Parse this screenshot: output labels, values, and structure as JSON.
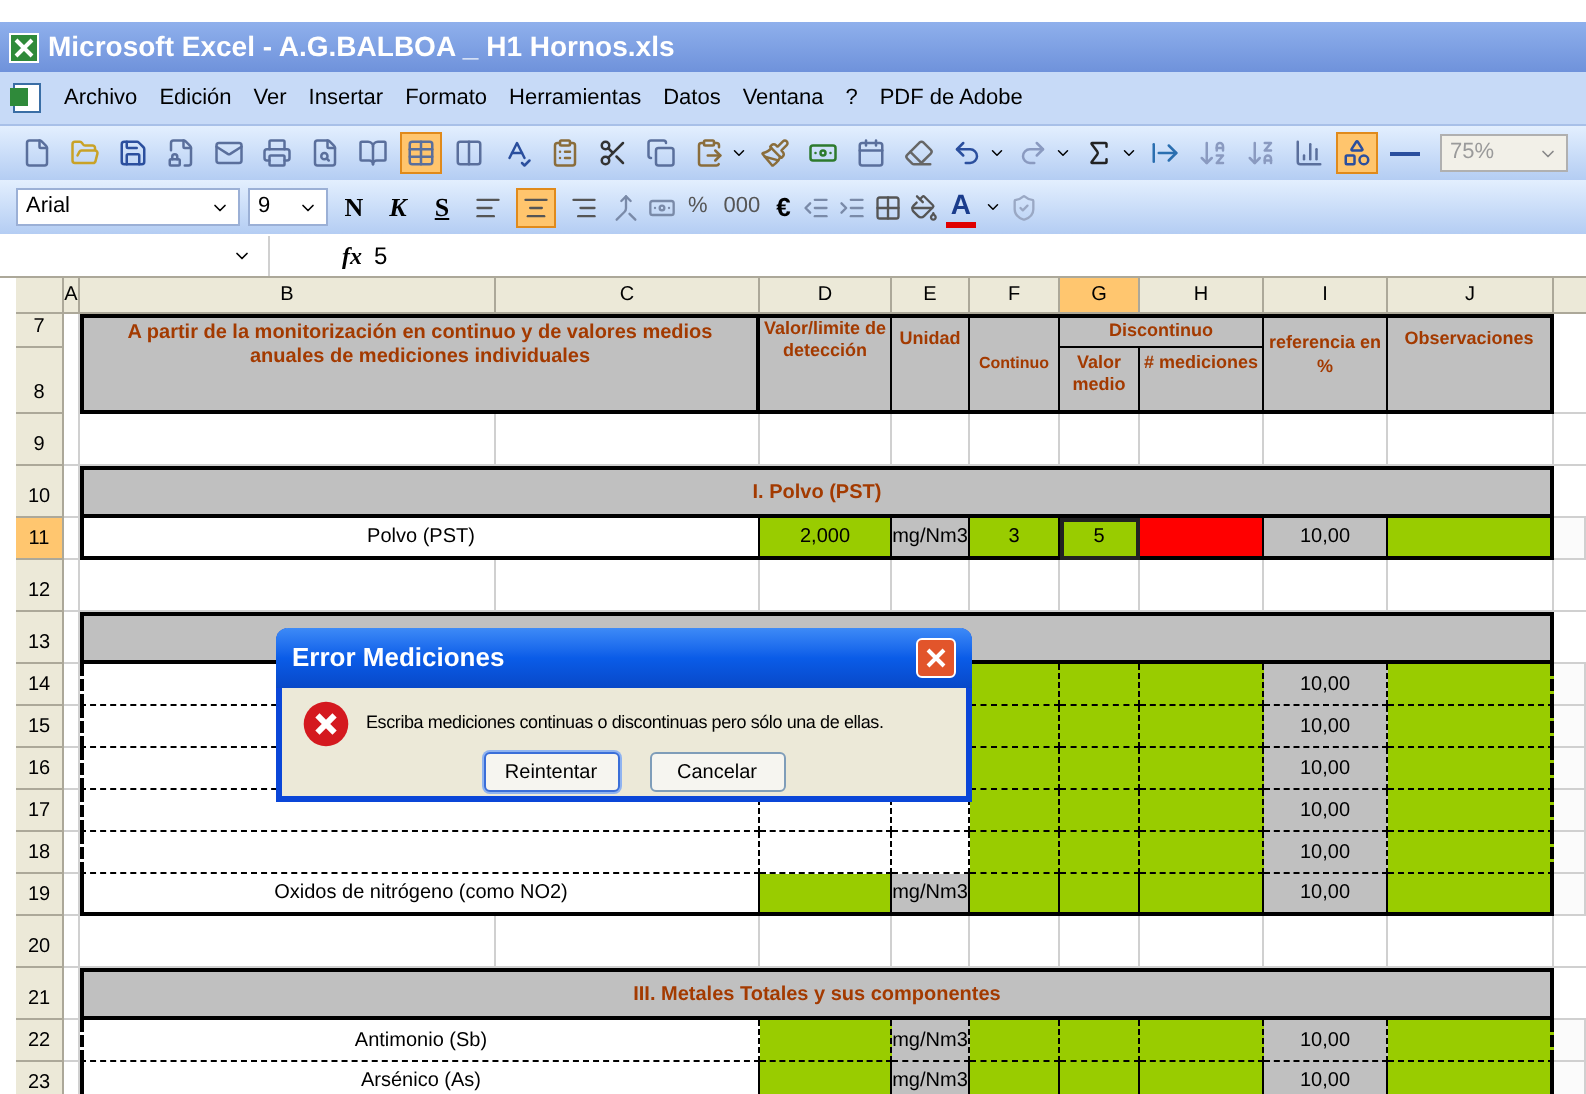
{
  "window": {
    "title": "Microsoft Excel - A.G.BALBOA _ H1 Hornos.xls"
  },
  "menu": [
    "Archivo",
    "Edición",
    "Ver",
    "Insertar",
    "Formato",
    "Herramientas",
    "Datos",
    "Ventana",
    "?",
    "PDF de Adobe"
  ],
  "standard_toolbar": {
    "buttons": [
      {
        "kind": "new",
        "selected": false
      },
      {
        "kind": "open",
        "selected": false
      },
      {
        "kind": "save",
        "selected": false
      },
      {
        "kind": "permission",
        "selected": false
      },
      {
        "kind": "mail",
        "selected": false
      },
      {
        "kind": "print",
        "selected": false
      },
      {
        "kind": "preview",
        "selected": false
      },
      {
        "kind": "research",
        "selected": false
      },
      {
        "kind": "grid",
        "selected": true
      },
      {
        "kind": "columns",
        "selected": false
      },
      {
        "kind": "spell",
        "selected": false
      },
      {
        "kind": "clipboard",
        "selected": false
      },
      {
        "kind": "cut",
        "selected": false
      },
      {
        "kind": "copy",
        "selected": false
      },
      {
        "kind": "paste",
        "selected": false
      },
      {
        "kind": "brush",
        "selected": false
      },
      {
        "kind": "money",
        "selected": false
      },
      {
        "kind": "calendar",
        "selected": false
      },
      {
        "kind": "eraser",
        "selected": false
      },
      {
        "kind": "undo",
        "selected": false
      },
      {
        "kind": "redo",
        "selected": false
      },
      {
        "kind": "sum",
        "selected": false
      },
      {
        "kind": "trace",
        "selected": false
      },
      {
        "kind": "sort_asc",
        "selected": false
      },
      {
        "kind": "sort_desc",
        "selected": false
      },
      {
        "kind": "chart",
        "selected": false
      },
      {
        "kind": "drawing",
        "selected": true
      },
      {
        "kind": "line",
        "selected": false
      }
    ],
    "zoom": "75%"
  },
  "format_toolbar": {
    "font": "Arial",
    "size": "9",
    "style_buttons": [
      "N",
      "K",
      "S"
    ],
    "align_buttons": [
      {
        "selected": false
      },
      {
        "selected": true
      },
      {
        "selected": false
      }
    ],
    "number_buttons": [
      "%",
      "000",
      "€"
    ],
    "font_color_letter": "A"
  },
  "formula_bar": {
    "function_label": "fx",
    "value": "5"
  },
  "columns": [
    {
      "label": "A",
      "selected": false
    },
    {
      "label": "B",
      "selected": false
    },
    {
      "label": "C",
      "selected": false
    },
    {
      "label": "D",
      "selected": false
    },
    {
      "label": "E",
      "selected": false
    },
    {
      "label": "F",
      "selected": false
    },
    {
      "label": "G",
      "selected": true
    },
    {
      "label": "H",
      "selected": false
    },
    {
      "label": "I",
      "selected": false
    },
    {
      "label": "J",
      "selected": false
    }
  ],
  "header": {
    "row_numbers": [
      "7",
      "8"
    ],
    "description": "A partir de la monitorización en continuo y de valores medios anuales de mediciones individuales",
    "limit": "Valor/limite de detección",
    "unit": "Unidad",
    "continuous": "Continuo",
    "discontinuous": "Discontinuo",
    "mean": "Valor medio",
    "count": "# mediciones",
    "reference": "referencia en %",
    "notes": "Observaciones"
  },
  "rows": [
    {
      "number": "9",
      "selected": false,
      "kind": "blank"
    },
    {
      "number": "10",
      "selected": false,
      "kind": "section",
      "title": "I. Polvo (PST)"
    },
    {
      "number": "11",
      "selected": true,
      "kind": "data",
      "cells": [
        {
          "text": "Polvo (PST)",
          "color": "#ffffff",
          "selected": false
        },
        {
          "text": "2,000",
          "color": "#99cc00",
          "selected": false
        },
        {
          "text": "mg/Nm3",
          "color": "#c0c0c0",
          "selected": false
        },
        {
          "text": "3",
          "color": "#99cc00",
          "selected": false
        },
        {
          "text": "5",
          "color": "#99cc00",
          "selected": true
        },
        {
          "color": "#ff0000",
          "selected": false
        },
        {
          "text": "10,00",
          "color": "#c0c0c0",
          "selected": false
        },
        {
          "color": "#99cc00",
          "selected": false
        }
      ]
    },
    {
      "number": "12",
      "selected": false,
      "kind": "blank"
    },
    {
      "number": "13",
      "selected": false,
      "kind": "section"
    },
    {
      "number": "14",
      "selected": false,
      "kind": "data",
      "cells": [
        {},
        {},
        {},
        {
          "color": "#99cc00",
          "selected": false
        },
        {
          "color": "#99cc00",
          "selected": false
        },
        {
          "color": "#99cc00",
          "selected": false
        },
        {
          "text": "10,00",
          "color": "#c0c0c0",
          "selected": false
        },
        {
          "color": "#99cc00",
          "selected": false
        }
      ]
    },
    {
      "number": "15",
      "selected": false,
      "kind": "data",
      "cells": [
        {},
        {},
        {},
        {
          "color": "#99cc00",
          "selected": false
        },
        {
          "color": "#99cc00",
          "selected": false
        },
        {
          "color": "#99cc00",
          "selected": false
        },
        {
          "text": "10,00",
          "color": "#c0c0c0",
          "selected": false
        },
        {
          "color": "#99cc00",
          "selected": false
        }
      ]
    },
    {
      "number": "16",
      "selected": false,
      "kind": "data",
      "cells": [
        {},
        {},
        {},
        {
          "color": "#99cc00",
          "selected": false
        },
        {
          "color": "#99cc00",
          "selected": false
        },
        {
          "color": "#99cc00",
          "selected": false
        },
        {
          "text": "10,00",
          "color": "#c0c0c0",
          "selected": false
        },
        {
          "color": "#99cc00",
          "selected": false
        }
      ]
    },
    {
      "number": "17",
      "selected": false,
      "kind": "data",
      "cells": [
        {},
        {},
        {},
        {
          "color": "#99cc00",
          "selected": false
        },
        {
          "color": "#99cc00",
          "selected": false
        },
        {
          "color": "#99cc00",
          "selected": false
        },
        {
          "text": "10,00",
          "color": "#c0c0c0",
          "selected": false
        },
        {
          "color": "#99cc00",
          "selected": false
        }
      ]
    },
    {
      "number": "18",
      "selected": false,
      "kind": "data",
      "cells": [
        {},
        {},
        {},
        {
          "color": "#99cc00",
          "selected": false
        },
        {
          "color": "#99cc00",
          "selected": false
        },
        {
          "color": "#99cc00",
          "selected": false
        },
        {
          "text": "10,00",
          "color": "#c0c0c0",
          "selected": false
        },
        {
          "color": "#99cc00",
          "selected": false
        }
      ]
    },
    {
      "number": "19",
      "selected": false,
      "kind": "data",
      "cells": [
        {
          "text": "Oxidos de nitrógeno  (como NO2)",
          "color": "#ffffff",
          "selected": false
        },
        {
          "color": "#99cc00",
          "selected": false
        },
        {
          "text": "mg/Nm3",
          "color": "#c0c0c0",
          "selected": false
        },
        {
          "color": "#99cc00",
          "selected": false
        },
        {
          "color": "#99cc00",
          "selected": false
        },
        {
          "color": "#99cc00",
          "selected": false
        },
        {
          "text": "10,00",
          "color": "#c0c0c0",
          "selected": false
        },
        {
          "color": "#99cc00",
          "selected": false
        }
      ]
    },
    {
      "number": "20",
      "selected": false,
      "kind": "blank"
    },
    {
      "number": "21",
      "selected": false,
      "kind": "section",
      "title": "III. Metales Totales y sus componentes"
    },
    {
      "number": "22",
      "selected": false,
      "kind": "data",
      "cells": [
        {
          "text": "Antimonio (Sb)",
          "color": "#ffffff",
          "selected": false
        },
        {
          "color": "#99cc00",
          "selected": false
        },
        {
          "text": "mg/Nm3",
          "color": "#c0c0c0",
          "selected": false
        },
        {
          "color": "#99cc00",
          "selected": false
        },
        {
          "color": "#99cc00",
          "selected": false
        },
        {
          "color": "#99cc00",
          "selected": false
        },
        {
          "text": "10,00",
          "color": "#c0c0c0",
          "selected": false
        },
        {
          "color": "#99cc00",
          "selected": false
        }
      ]
    },
    {
      "number": "23",
      "selected": false,
      "kind": "data",
      "cells": [
        {
          "text": "Arsénico (As)",
          "color": "#ffffff",
          "selected": false
        },
        {
          "color": "#99cc00",
          "selected": false
        },
        {
          "text": "mg/Nm3",
          "color": "#c0c0c0",
          "selected": false
        },
        {
          "color": "#99cc00",
          "selected": false
        },
        {
          "color": "#99cc00",
          "selected": false
        },
        {
          "color": "#99cc00",
          "selected": false
        },
        {
          "text": "10,00",
          "color": "#c0c0c0",
          "selected": false
        },
        {
          "color": "#99cc00",
          "selected": false
        }
      ]
    }
  ],
  "dialog": {
    "title": "Error Mediciones",
    "message": "Escriba mediciones continuas o discontinuas pero sólo una de ellas.",
    "buttons": [
      {
        "label": "Reintentar",
        "selected": true
      },
      {
        "label": "Cancelar",
        "selected": false
      }
    ]
  }
}
